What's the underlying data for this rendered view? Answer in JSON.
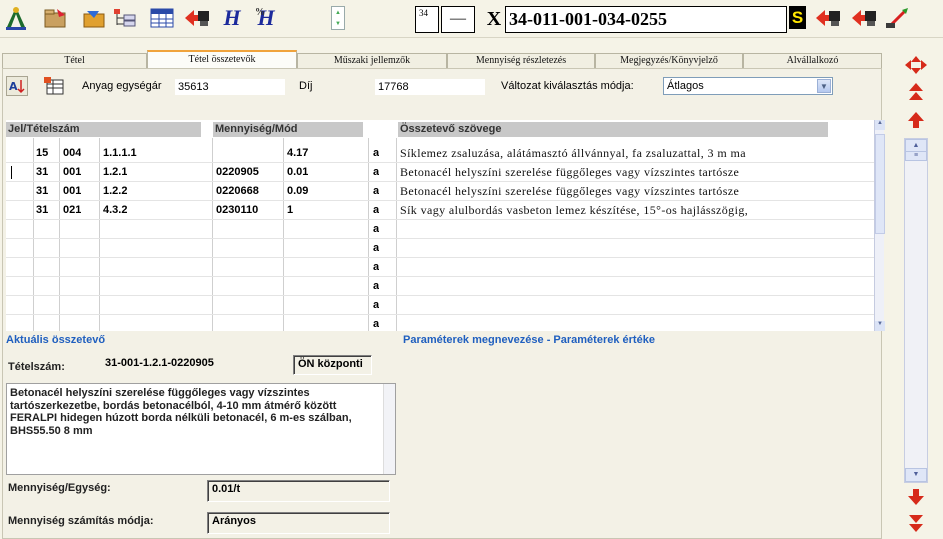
{
  "toolbar": {
    "h_button_1": "H",
    "h_button_2": "H",
    "small_box_value": "34",
    "dash_box_value": "—",
    "x_label": "X",
    "item_code": "34-011-001-034-0255",
    "s_badge": "S"
  },
  "tabs": [
    {
      "label": "Tétel"
    },
    {
      "label": "Tétel összetevők"
    },
    {
      "label": "Műszaki jellemzők"
    },
    {
      "label": "Mennyiség részletezés"
    },
    {
      "label": "Megjegyzés/Könyvjelző"
    },
    {
      "label": "Alvállalkozó"
    }
  ],
  "header_row": {
    "unit_price_label": "Anyag egységár",
    "unit_price_value": "35613",
    "fee_label": "Díj",
    "fee_value": "17768",
    "mode_label": "Változat kiválasztás módja:",
    "mode_value": "Átlagos"
  },
  "grid": {
    "columns": {
      "code": "Jel/Tételszám",
      "quantity": "Mennyiség/Mód",
      "text": "Összetevő szövege"
    },
    "rows": [
      {
        "c1": "15",
        "c2": "004",
        "c3": "1.1.1.1",
        "c4": "",
        "c5": "4.17",
        "c6": "a",
        "text": "Síklemez zsaluzása, alátámasztó állvánnyal, fa zsaluzattal, 3 m ma"
      },
      {
        "c1": "31",
        "c2": "001",
        "c3": "1.2.1",
        "c4": "0220905",
        "c5": "0.01",
        "c6": "a",
        "text": "Betonacél helyszíni szerelése  függőleges vagy vízszintes tartósze"
      },
      {
        "c1": "31",
        "c2": "001",
        "c3": "1.2.2",
        "c4": "0220668",
        "c5": "0.09",
        "c6": "a",
        "text": "Betonacél helyszíni szerelése  függőleges vagy vízszintes tartósze"
      },
      {
        "c1": "31",
        "c2": "021",
        "c3": "4.3.2",
        "c4": "0230110",
        "c5": "1",
        "c6": "a",
        "text": "Sík vagy alulbordás vasbeton lemez készítése, 15°-os hajlásszögig,"
      },
      {
        "c1": "",
        "c2": "",
        "c3": "",
        "c4": "",
        "c5": "",
        "c6": "a",
        "text": ""
      },
      {
        "c1": "",
        "c2": "",
        "c3": "",
        "c4": "",
        "c5": "",
        "c6": "a",
        "text": ""
      },
      {
        "c1": "",
        "c2": "",
        "c3": "",
        "c4": "",
        "c5": "",
        "c6": "a",
        "text": ""
      },
      {
        "c1": "",
        "c2": "",
        "c3": "",
        "c4": "",
        "c5": "",
        "c6": "a",
        "text": ""
      },
      {
        "c1": "",
        "c2": "",
        "c3": "",
        "c4": "",
        "c5": "",
        "c6": "a",
        "text": ""
      },
      {
        "c1": "",
        "c2": "",
        "c3": "",
        "c4": "",
        "c5": "",
        "c6": "a",
        "text": ""
      }
    ]
  },
  "current_component": {
    "title": "Aktuális összetevő",
    "item_no_label": "Tételszám:",
    "item_no_value": "31-001-1.2.1-0220905",
    "source_value": "ÖN központi",
    "description": "Betonacél helyszíni szerelése  függőleges vagy vízszintes tartószerkezetbe, bordás betonacélból, 4-10 mm átmérő között FERALPI hidegen húzott borda nélküli betonacél, 6 m-es szálban, BHS55.50  8 mm",
    "qty_unit_label": "Mennyiség/Egység:",
    "qty_unit_value": "0.01/t",
    "calc_mode_label": "Mennyiség számítás módja:",
    "calc_mode_value": "Arányos"
  },
  "parameters": {
    "title": "Paraméterek megnevezése - Paraméterek értéke"
  },
  "icons": {
    "toolbar": [
      "app-logo-icon",
      "open-folder-icon",
      "import-icon",
      "tree-view-icon",
      "grid-icon",
      "back-arrow-icon",
      "h-icon",
      "h-percent-icon",
      "stepper-icon",
      "print-icon",
      "print-arrow-icon",
      "wand-icon"
    ],
    "nav": [
      "expand-icon",
      "double-up-icon",
      "up-icon",
      "down-icon",
      "double-down-icon"
    ]
  }
}
